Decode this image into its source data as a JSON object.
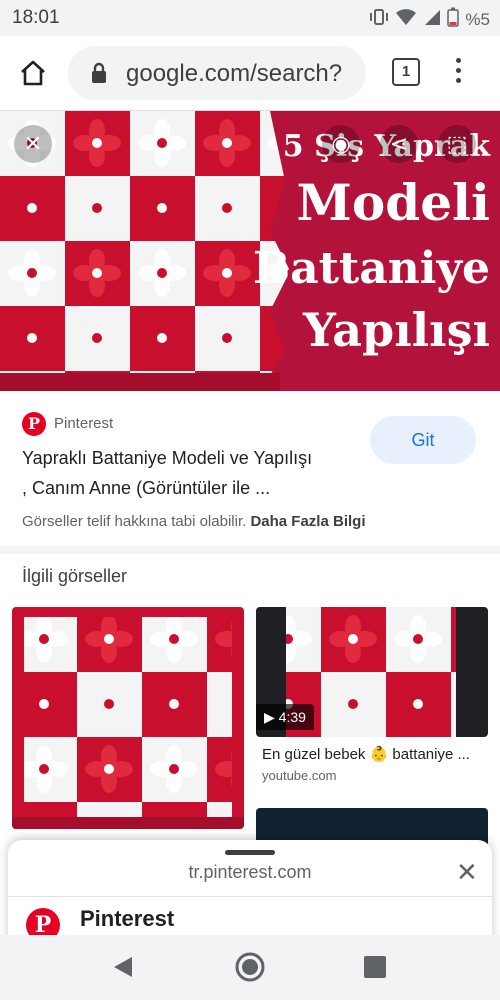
{
  "status": {
    "time": "18:01",
    "battery": "%5"
  },
  "browser": {
    "url": "google.com/search?",
    "tab_count": "1"
  },
  "hero": {
    "banner_line1": "5 Şiş Yaprak",
    "banner_line2": "Modeli",
    "banner_line3": "Battaniye",
    "banner_line4": "Yapılışı"
  },
  "result": {
    "source": "Pinterest",
    "visit_label": "Git",
    "title_line1": "Yapraklı Battaniye Modeli ve Yapılışı",
    "title_line2": ", Canım Anne (Görüntüler ile ...",
    "copyright_text": "Görseller telif hakkına tabi olabilir.",
    "more_info": "Daha Fazla Bilgi"
  },
  "related": {
    "heading": "İlgili görseller",
    "items": [
      {
        "duration": "4:39",
        "caption": "En güzel bebek 👶 battaniye ...",
        "source": "youtube.com"
      }
    ]
  },
  "sheet": {
    "url": "tr.pinterest.com",
    "title": "Pinterest"
  },
  "colors": {
    "accent_red": "#b3123a",
    "pinterest_red": "#e60023",
    "google_blue": "#1a73e8"
  }
}
